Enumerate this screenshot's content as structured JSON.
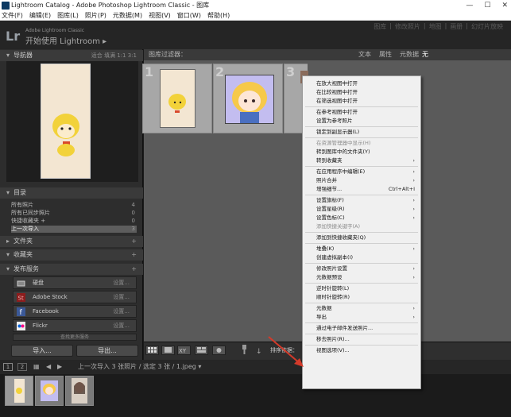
{
  "window": {
    "title": "Lightroom Catalog - Adobe Photoshop Lightroom Classic - 图库",
    "controls": [
      "—",
      "☐",
      "✕"
    ]
  },
  "menubar": [
    "文件(F)",
    "编辑(E)",
    "图库(L)",
    "照片(P)",
    "元数据(M)",
    "视图(V)",
    "窗口(W)",
    "帮助(H)"
  ],
  "identity": {
    "logo": "Lr",
    "sub": "Adobe Lightroom Classic",
    "title": "开始使用 Lightroom ▸",
    "modules": [
      "图库",
      "|",
      "修改照片",
      "|",
      "地图",
      "|",
      "画册",
      "|",
      "幻灯片放映"
    ]
  },
  "left_panel": {
    "navigator": {
      "title": "导航器",
      "zoom": "适合  填满  1:1  3:1"
    },
    "catalog": {
      "title": "目录",
      "rows": [
        {
          "label": "所有照片",
          "count": "4"
        },
        {
          "label": "所有已同步照片",
          "count": "0"
        },
        {
          "label": "快捷收藏夹 +",
          "count": "0"
        },
        {
          "label": "上一次导入",
          "count": "3"
        }
      ]
    },
    "folders": "文件夹",
    "collections": "收藏夹",
    "publish": {
      "title": "发布服务",
      "services": [
        {
          "label": "硬盘",
          "setup": "设置..."
        },
        {
          "label": "Adobe Stock",
          "setup": "设置..."
        },
        {
          "label": "Facebook",
          "setup": "设置..."
        },
        {
          "label": "Flickr",
          "setup": "设置..."
        }
      ],
      "more": "查找更多服务"
    },
    "import_btn": "导入...",
    "export_btn": "导出..."
  },
  "main": {
    "filter_label": "图库过滤器：",
    "filters": [
      "文本",
      "属性",
      "元数据",
      "无"
    ],
    "cells": [
      "1",
      "2",
      "3"
    ],
    "sort_label": "排序依据："
  },
  "filmstrip": {
    "pages": [
      "1",
      "2"
    ],
    "source": "上一次导入  3 张照片 / 选定 3 张 / 1.jpeg ▾"
  },
  "context_menu": {
    "items": [
      {
        "label": "在放大视图中打开",
        "type": "item"
      },
      {
        "label": "在比较视图中打开",
        "type": "item"
      },
      {
        "label": "在筛选视图中打开",
        "type": "item"
      },
      {
        "type": "sep"
      },
      {
        "label": "在参考视图中打开",
        "type": "item"
      },
      {
        "label": "设置为参考照片",
        "type": "item"
      },
      {
        "type": "sep"
      },
      {
        "label": "锁定到副显示器(L)",
        "type": "item"
      },
      {
        "type": "sep"
      },
      {
        "label": "在资源管理器中显示(H)",
        "type": "dis"
      },
      {
        "label": "转到图库中的文件夹(Y)",
        "type": "item"
      },
      {
        "label": "转到收藏夹",
        "type": "sub"
      },
      {
        "type": "sep"
      },
      {
        "label": "在应用程序中编辑(E)",
        "type": "sub"
      },
      {
        "label": "照片合并",
        "type": "sub"
      },
      {
        "label": "增强细节...",
        "type": "item",
        "shortcut": "Ctrl+Alt+I"
      },
      {
        "type": "sep"
      },
      {
        "label": "设置旗标(F)",
        "type": "sub"
      },
      {
        "label": "设置星级(R)",
        "type": "sub"
      },
      {
        "label": "设置色标(C)",
        "type": "sub"
      },
      {
        "label": "添加快捷关键字(A)",
        "type": "dis"
      },
      {
        "type": "sep"
      },
      {
        "label": "添加到快捷收藏夹(Q)",
        "type": "item"
      },
      {
        "type": "sep"
      },
      {
        "label": "堆叠(K)",
        "type": "sub"
      },
      {
        "label": "创建虚拟副本(I)",
        "type": "item"
      },
      {
        "type": "sep"
      },
      {
        "label": "修改照片设置",
        "type": "sub"
      },
      {
        "label": "元数据预设",
        "type": "sub"
      },
      {
        "type": "sep"
      },
      {
        "label": "逆时针旋转(L)",
        "type": "item"
      },
      {
        "label": "顺时针旋转(R)",
        "type": "item"
      },
      {
        "type": "sep"
      },
      {
        "label": "元数据",
        "type": "sub"
      },
      {
        "label": "导出",
        "type": "sub"
      },
      {
        "type": "sep"
      },
      {
        "label": "通过电子邮件发送照片...",
        "type": "item"
      },
      {
        "type": "sep"
      },
      {
        "label": "移去照片(R)...",
        "type": "item"
      },
      {
        "type": "sep"
      },
      {
        "label": "视图选项(V)...",
        "type": "item"
      }
    ]
  },
  "colors": {
    "accent": "#d43a2a",
    "panel": "#2d2d2d",
    "grid": "#5a5a5a"
  }
}
